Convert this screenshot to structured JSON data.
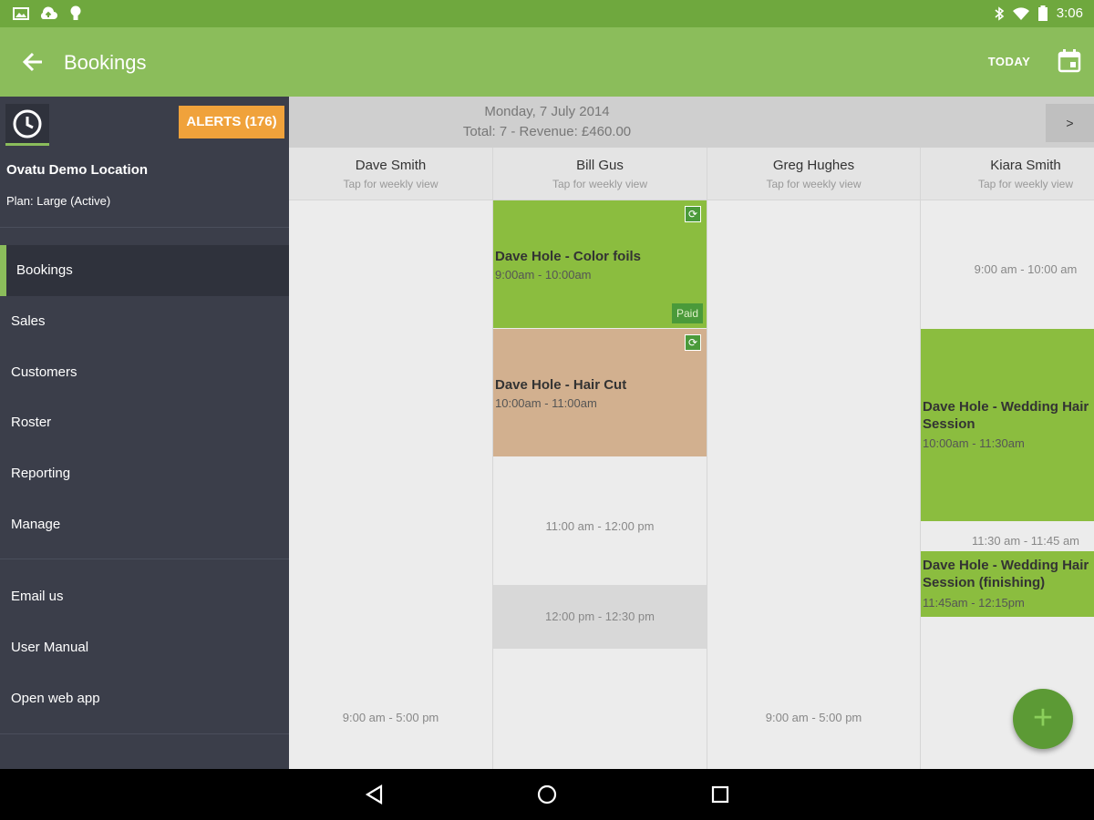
{
  "status_bar": {
    "time": "3:06",
    "left_icons": [
      "image-icon",
      "cloud-upload-icon",
      "lightbulb-icon"
    ],
    "right_icons": [
      "bluetooth-icon",
      "wifi-icon",
      "battery-icon"
    ]
  },
  "app_bar": {
    "title": "Bookings",
    "today_label": "TODAY",
    "back_icon": "arrow-left-icon",
    "calendar_icon": "calendar-icon",
    "color": "#8bbd5b"
  },
  "drawer": {
    "alerts_label": "ALERTS (176)",
    "location_name": "Ovatu Demo Location",
    "plan": "Plan: Large (Active)",
    "nav_items": [
      {
        "label": "Bookings",
        "active": true
      },
      {
        "label": "Sales"
      },
      {
        "label": "Customers"
      },
      {
        "label": "Roster"
      },
      {
        "label": "Reporting"
      },
      {
        "label": "Manage"
      }
    ],
    "secondary_items": [
      {
        "label": "Email us"
      },
      {
        "label": "User Manual"
      },
      {
        "label": "Open web app"
      }
    ]
  },
  "schedule": {
    "date": "Monday, 7 July 2014",
    "summary": "Total: 7 - Revenue: £460.00",
    "next_label": ">",
    "columns": [
      {
        "name": "Dave Smith",
        "subtitle": "Tap for weekly view",
        "slots": [
          {
            "time": "9:00 am - 5:00 pm"
          }
        ]
      },
      {
        "name": "Bill Gus",
        "subtitle": "Tap for weekly view",
        "bookings": [
          {
            "title": "Dave Hole - Color foils",
            "time": "9:00am - 10:00am",
            "badge": "Paid",
            "color": "#8bbd3f"
          },
          {
            "title": "Dave Hole - Hair Cut",
            "time": "10:00am - 11:00am",
            "color": "#d2b08f"
          }
        ],
        "slots": [
          {
            "time": "11:00 am - 12:00 pm"
          },
          {
            "time": "12:00 pm - 12:30 pm"
          }
        ]
      },
      {
        "name": "Greg Hughes",
        "subtitle": "Tap for weekly view",
        "slots": [
          {
            "time": "9:00 am - 5:00 pm"
          }
        ]
      },
      {
        "name": "Kiara Smith",
        "subtitle": "Tap for weekly view",
        "slots": [
          {
            "time": "9:00 am - 10:00 am"
          },
          {
            "time": "11:30 am - 11:45 am"
          }
        ],
        "bookings": [
          {
            "title": "Dave Hole - Wedding Hair Session",
            "time": "10:00am - 11:30am",
            "color": "#8bbd3f"
          },
          {
            "title": "Dave Hole - Wedding Hair Session (finishing)",
            "time": "11:45am - 12:15pm",
            "color": "#8bbd3f"
          }
        ]
      }
    ]
  },
  "fab": {
    "icon": "plus-icon",
    "label": "+"
  },
  "nav_bar": {
    "icons": [
      "back-triangle-icon",
      "home-circle-icon",
      "recents-square-icon"
    ]
  }
}
